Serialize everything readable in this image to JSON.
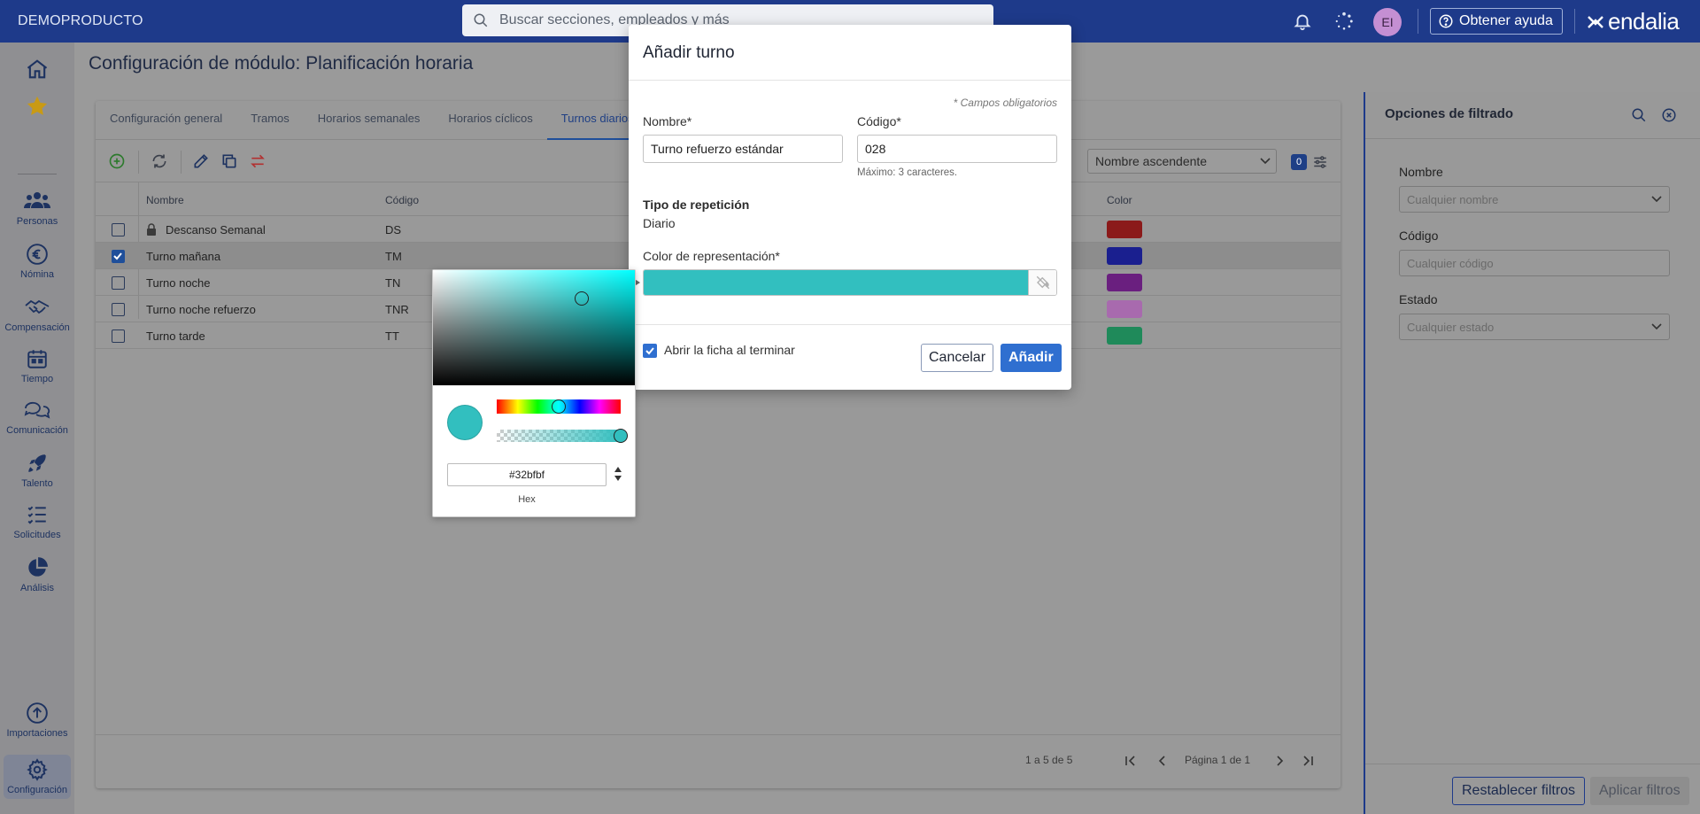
{
  "header": {
    "company": "DEMOPRODUCTO",
    "search_placeholder": "Buscar secciones, empleados y más",
    "avatar_initials": "EI",
    "help_label": "Obtener ayuda",
    "logo_text": "endalia"
  },
  "sidebar": {
    "items": [
      {
        "label": "Personas"
      },
      {
        "label": "Nómina"
      },
      {
        "label": "Compensación"
      },
      {
        "label": "Tiempo"
      },
      {
        "label": "Comunicación"
      },
      {
        "label": "Talento"
      },
      {
        "label": "Solicitudes"
      },
      {
        "label": "Análisis"
      },
      {
        "label": "Importaciones"
      },
      {
        "label": "Configuración"
      }
    ]
  },
  "page": {
    "title": "Configuración de módulo: Planificación horaria",
    "tabs": [
      "Configuración general",
      "Tramos",
      "Horarios semanales",
      "Horarios cíclicos",
      "Turnos diarios"
    ],
    "sort_value": "Nombre ascendente",
    "filter_count": "0"
  },
  "table": {
    "headers": {
      "name": "Nombre",
      "code": "Código",
      "color": "Color"
    },
    "rows": [
      {
        "name": "Descanso Semanal",
        "code": "DS",
        "locked": true,
        "checked": false,
        "color": "#8b1a1a"
      },
      {
        "name": "Turno mañana",
        "code": "TM",
        "locked": false,
        "checked": true,
        "color": "#1a1f8f"
      },
      {
        "name": "Turno noche",
        "code": "TN",
        "locked": false,
        "checked": false,
        "color": "#6a1f7f"
      },
      {
        "name": "Turno noche refuerzo",
        "code": "TNR",
        "locked": false,
        "checked": false,
        "color": "#a86aae"
      },
      {
        "name": "Turno tarde",
        "code": "TT",
        "locked": false,
        "checked": false,
        "color": "#1f8a5a"
      }
    ],
    "pager_info": "1 a 5 de 5",
    "pager_page": "Página 1 de 1"
  },
  "filters": {
    "title": "Opciones de filtrado",
    "name_label": "Nombre",
    "name_placeholder": "Cualquier nombre",
    "code_label": "Código",
    "code_placeholder": "Cualquier código",
    "state_label": "Estado",
    "state_placeholder": "Cualquier estado",
    "reset_label": "Restablecer filtros",
    "apply_label": "Aplicar filtros"
  },
  "modal": {
    "title": "Añadir turno",
    "required_note": "* Campos obligatorios",
    "name_label": "Nombre*",
    "name_value": "Turno refuerzo estándar",
    "code_label": "Código*",
    "code_value": "028",
    "code_hint": "Máximo: 3 caracteres.",
    "repeat_label": "Tipo de repetición",
    "repeat_value": "Diario",
    "color_label": "Color de representación*",
    "color_value": "#32bfbf",
    "open_after_label": "Abrir la ficha al terminar",
    "open_after_checked": true,
    "cancel_label": "Cancelar",
    "add_label": "Añadir"
  },
  "color_picker": {
    "hex_value": "#32bfbf",
    "hex_label": "Hex"
  }
}
